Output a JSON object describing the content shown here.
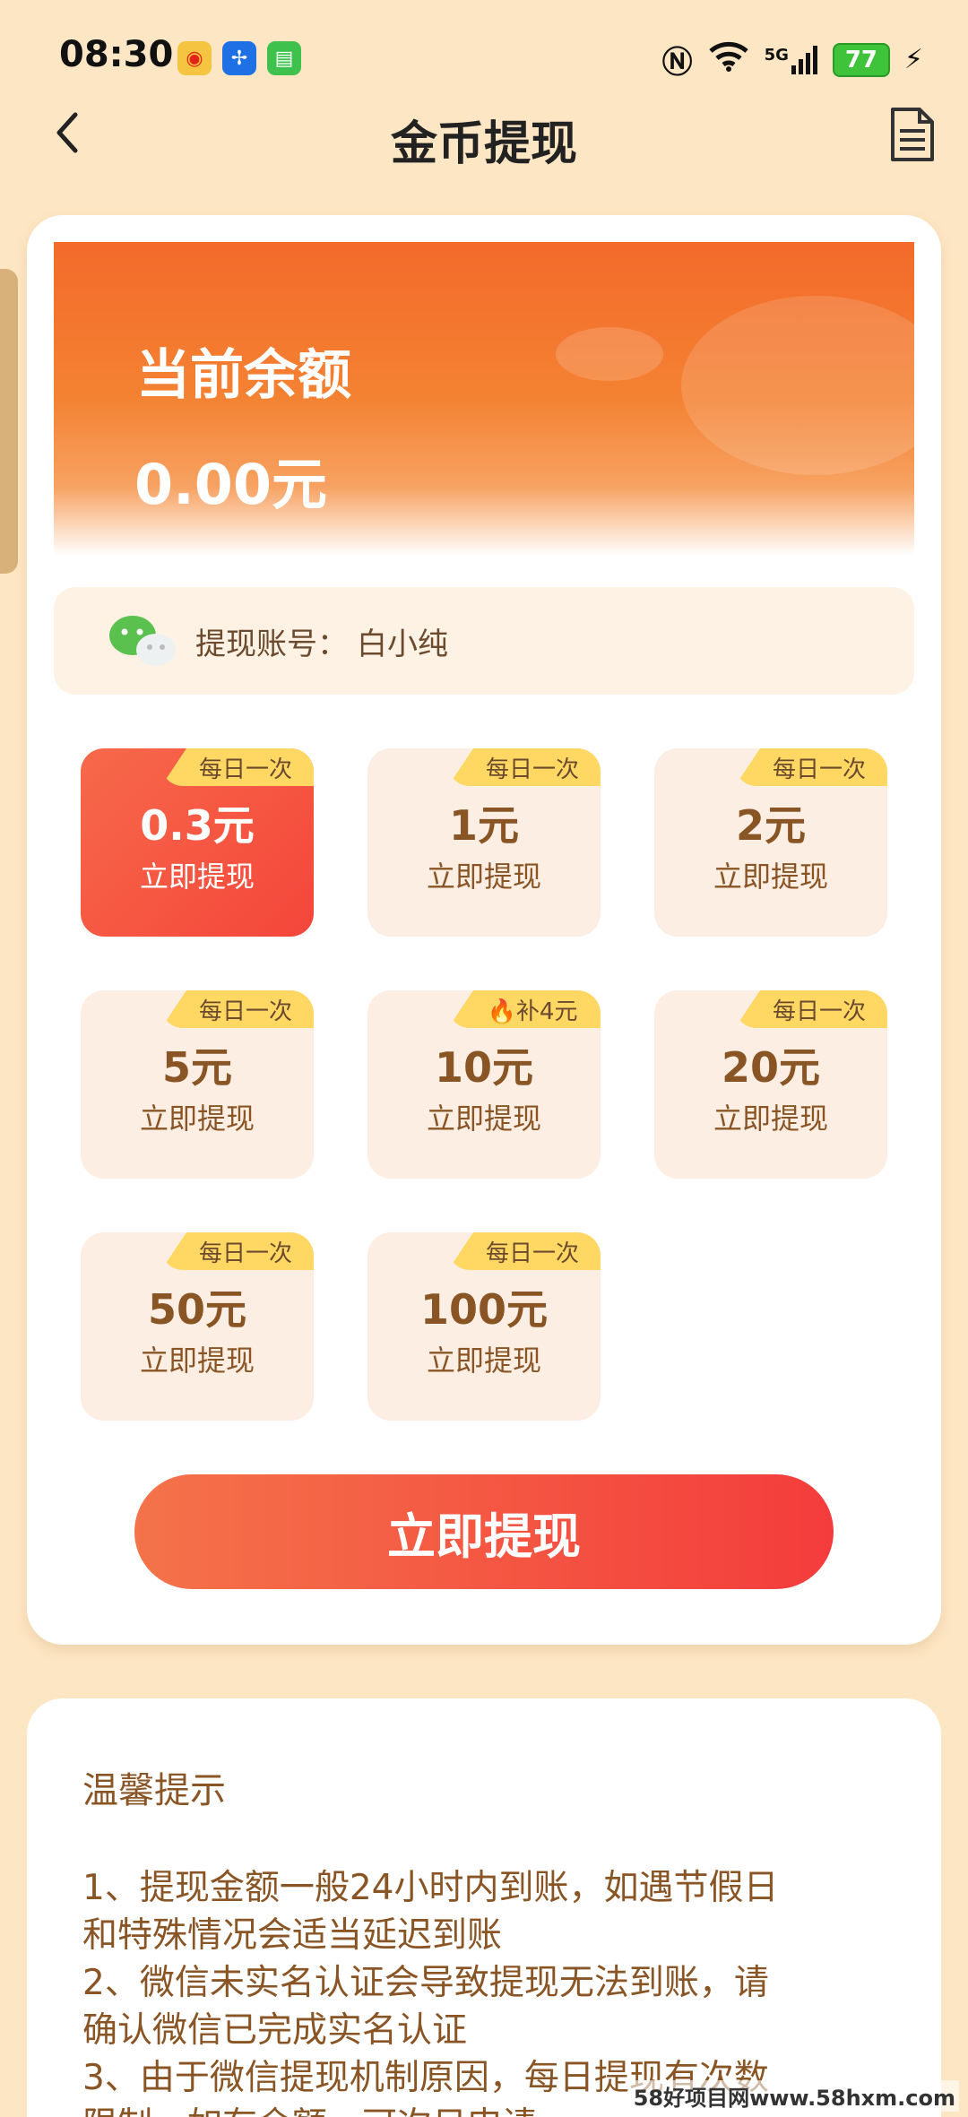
{
  "status_bar": {
    "time": "08:30",
    "network": "5G",
    "battery": "77"
  },
  "header": {
    "title": "金币提现"
  },
  "balance": {
    "label": "当前余额",
    "value": "0.00元"
  },
  "account": {
    "label": "提现账号：",
    "value": "白小纯"
  },
  "options": [
    {
      "badge": "每日一次",
      "amount": "0.3元",
      "action": "立即提现",
      "selected": true
    },
    {
      "badge": "每日一次",
      "amount": "1元",
      "action": "立即提现"
    },
    {
      "badge": "每日一次",
      "amount": "2元",
      "action": "立即提现"
    },
    {
      "badge": "每日一次",
      "amount": "5元",
      "action": "立即提现"
    },
    {
      "badge": "🔥补4元",
      "amount": "10元",
      "action": "立即提现"
    },
    {
      "badge": "每日一次",
      "amount": "20元",
      "action": "立即提现"
    },
    {
      "badge": "每日一次",
      "amount": "50元",
      "action": "立即提现"
    },
    {
      "badge": "每日一次",
      "amount": "100元",
      "action": "立即提现"
    }
  ],
  "withdraw_button": "立即提现",
  "tips": {
    "title": "温馨提示",
    "lines": [
      "1、提现金额一般24小时内到账，如遇节假日",
      "和特殊情况会适当延迟到账",
      "2、微信未实名认证会导致提现无法到账，请",
      "确认微信已完成实名认证",
      "3、由于微信提现机制原因，每日提现有次数",
      "限制，如有余额，可次日申请"
    ]
  },
  "watermark": "58好项目网www.58hxm.com",
  "colors": {
    "background": "#fde6c4",
    "accent_orange": "#f36a2a",
    "accent_red": "#f43c3c",
    "badge_yellow": "#ffd763",
    "text_brown": "#8a5525"
  }
}
